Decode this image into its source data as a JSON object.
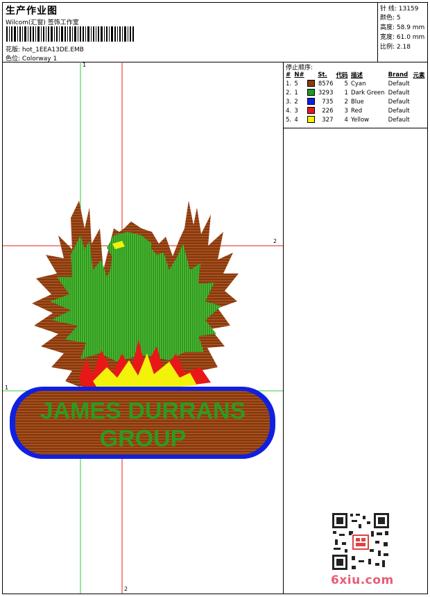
{
  "header": {
    "title": "生产作业图",
    "company": "Wilcom(汇窗) 签饰工作室",
    "design_label": "花版:",
    "design_value": "hot_1EEA13DE.EMB",
    "color_label": "色位:",
    "color_value": "Colorway 1"
  },
  "stats": {
    "stitches": "针 线: 13159",
    "colors": "颜色: 5",
    "height": "高度: 58.9 mm",
    "width": "宽度: 61.0 mm",
    "scale": "比例: 2.18"
  },
  "stop_sequence": {
    "label": "停止顺序:",
    "headers": [
      "#",
      "N#",
      "",
      "St.",
      "代码",
      "描述",
      "Brand",
      "元素"
    ],
    "rows": [
      {
        "n": "1.",
        "nn": "5",
        "color": "#8B3A0F",
        "st": "8576",
        "code": "5",
        "desc": "Cyan",
        "brand": "Default"
      },
      {
        "n": "2.",
        "nn": "1",
        "color": "#1E9A1E",
        "st": "3293",
        "code": "1",
        "desc": "Dark Green",
        "brand": "Default"
      },
      {
        "n": "3.",
        "nn": "2",
        "color": "#1020E0",
        "st": "735",
        "code": "2",
        "desc": "Blue",
        "brand": "Default"
      },
      {
        "n": "4.",
        "nn": "3",
        "color": "#E81818",
        "st": "226",
        "code": "3",
        "desc": "Red",
        "brand": "Default"
      },
      {
        "n": "5.",
        "nn": "4",
        "color": "#F2F20A",
        "st": "327",
        "code": "4",
        "desc": "Yellow",
        "brand": "Default"
      }
    ]
  },
  "guides": {
    "v1": "1",
    "h2": "2",
    "h1": "1",
    "v2": "2"
  },
  "artwork": {
    "line1": "JAMES DURRANS",
    "line2": "GROUP",
    "colors": {
      "brown": "#8B3A0F",
      "green": "#2E9A1E",
      "blue": "#1020E0",
      "red": "#E81818",
      "yellow": "#F2F20A"
    }
  },
  "watermark": {
    "site": "6xiu.com"
  }
}
